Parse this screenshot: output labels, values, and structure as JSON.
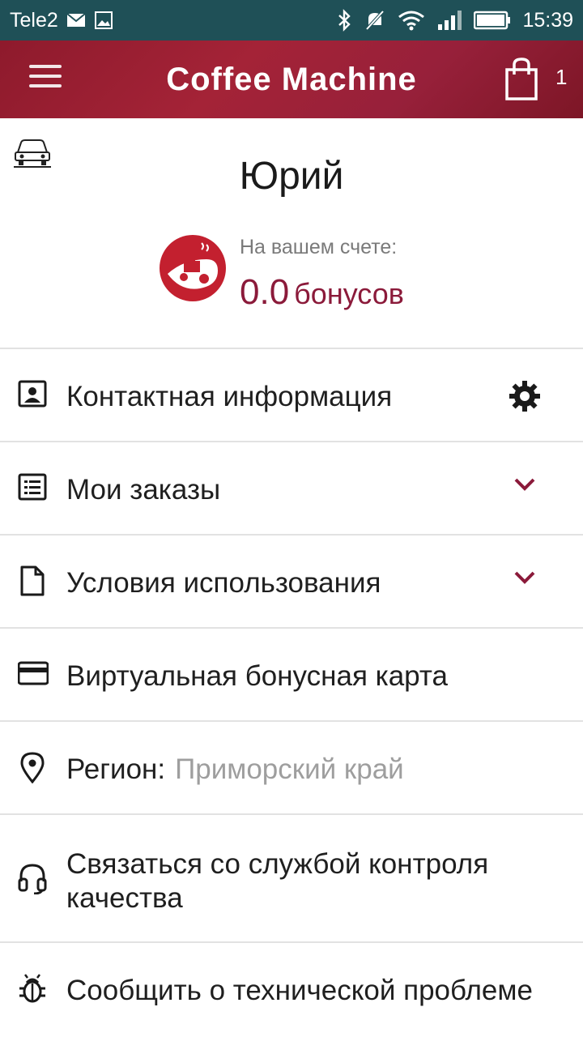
{
  "status_bar": {
    "carrier": "Tele2",
    "time": "15:39"
  },
  "app_bar": {
    "title": "Coffee Machine",
    "cart_count": "1"
  },
  "profile": {
    "name": "Юрий",
    "balance_label": "На вашем счете:",
    "balance_value": "0.0",
    "balance_unit": "бонусов"
  },
  "menu": {
    "contact": {
      "label": "Контактная информация",
      "icon": "contact-card-icon",
      "right_icon": "settings-gear-icon"
    },
    "orders": {
      "label": "Мои заказы",
      "icon": "list-icon",
      "right_icon": "chevron-down-icon"
    },
    "terms": {
      "label": "Условия использования",
      "icon": "document-icon",
      "right_icon": "chevron-down-icon"
    },
    "card": {
      "label": "Виртуальная бонусная карта",
      "icon": "credit-card-icon"
    },
    "region": {
      "label": "Регион:",
      "value": "Приморский край",
      "icon": "location-pin-icon"
    },
    "support": {
      "label": "Связаться со службой контроля качества",
      "icon": "headset-icon"
    },
    "bug": {
      "label": "Сообщить о технической проблеме",
      "icon": "bug-icon"
    }
  },
  "colors": {
    "accent": "#8b1a3a",
    "appbar": "#a42337",
    "statusbar": "#1f5057"
  }
}
